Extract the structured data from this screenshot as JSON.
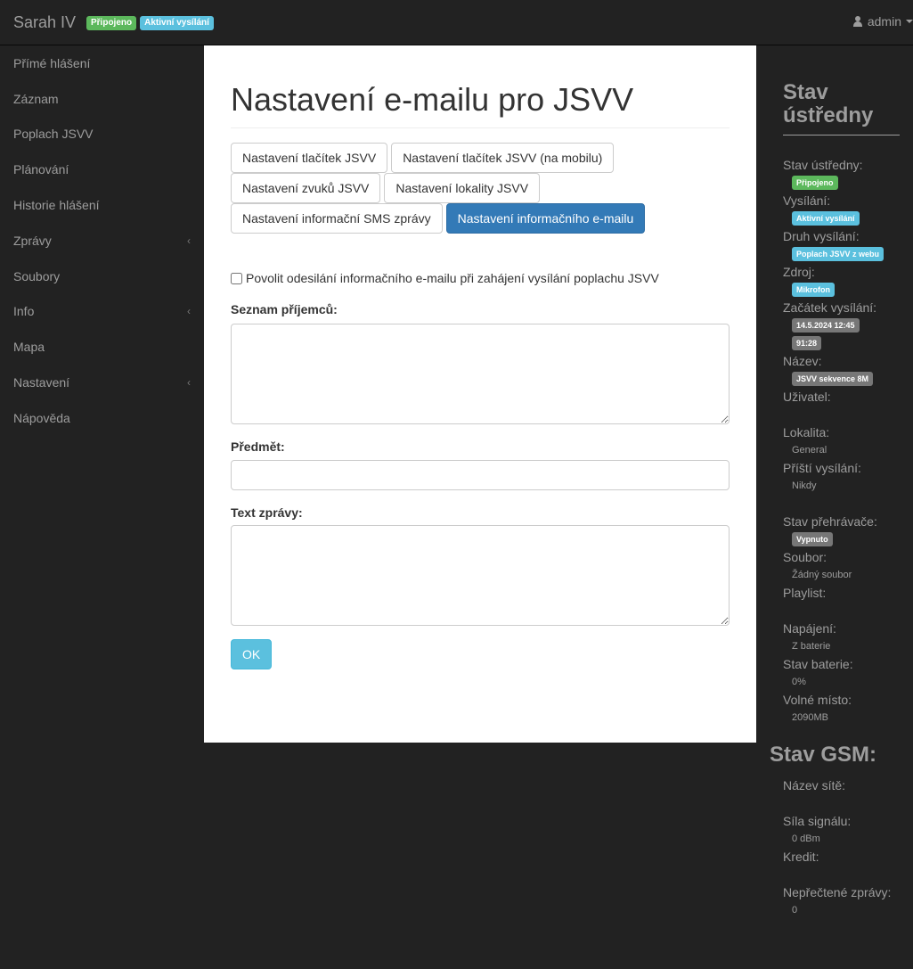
{
  "navbar": {
    "brand": "Sarah IV",
    "badge_connected": "Připojeno",
    "badge_broadcast": "Aktivní vysílání",
    "user": "admin"
  },
  "sidebar": {
    "items": [
      {
        "label": "Přímé hlášení",
        "has_chevron": false
      },
      {
        "label": "Záznam",
        "has_chevron": false
      },
      {
        "label": "Poplach JSVV",
        "has_chevron": false
      },
      {
        "label": "Plánování",
        "has_chevron": false
      },
      {
        "label": "Historie hlášení",
        "has_chevron": false
      },
      {
        "label": "Zprávy",
        "has_chevron": true
      },
      {
        "label": "Soubory",
        "has_chevron": false
      },
      {
        "label": "Info",
        "has_chevron": true
      },
      {
        "label": "Mapa",
        "has_chevron": false
      },
      {
        "label": "Nastavení",
        "has_chevron": true
      },
      {
        "label": "Nápověda",
        "has_chevron": false
      }
    ],
    "chevron": "‹"
  },
  "main": {
    "title": "Nastavení e-mailu pro JSVV",
    "tabs": [
      "Nastavení tlačítek JSVV",
      "Nastavení tlačítek JSVV (na mobilu)",
      "Nastavení zvuků JSVV",
      "Nastavení lokality JSVV",
      "Nastavení informační SMS zprávy",
      "Nastavení informačního e-mailu"
    ],
    "active_tab": 5,
    "checkbox_label": "Povolit odesilání informačního e-mailu při zahájení vysílání poplachu JSVV",
    "checkbox_checked": false,
    "recipients_label": "Seznam příjemců:",
    "recipients_value": "",
    "subject_label": "Předmět:",
    "subject_value": "",
    "message_label": "Text zprávy:",
    "message_value": "",
    "ok_label": "OK"
  },
  "status": {
    "title": "Stav ústředny",
    "central_state_label": "Stav ústředny:",
    "central_state": "Připojeno",
    "broadcast_label": "Vysílání:",
    "broadcast": "Aktivní vysílání",
    "broadcast_type_label": "Druh vysílání:",
    "broadcast_type": "Poplach JSVV z webu",
    "source_label": "Zdroj:",
    "source": "Mikrofon",
    "start_label": "Začátek vysílání:",
    "start_time": "14.5.2024 12:45",
    "duration": "91:28",
    "name_label": "Název:",
    "name": "JSVV sekvence 8M",
    "user_label": "Uživatel:",
    "location_label": "Lokalita:",
    "location": "General",
    "next_label": "Příští vysílání:",
    "next": "Nikdy",
    "player_label": "Stav přehrávače:",
    "player": "Vypnuto",
    "file_label": "Soubor:",
    "file": "Žádný soubor",
    "playlist_label": "Playlist:",
    "power_label": "Napájení:",
    "power": "Z baterie",
    "battery_label": "Stav baterie:",
    "battery": "0%",
    "space_label": "Volné místo:",
    "space": "2090MB"
  },
  "gsm": {
    "title": "Stav GSM:",
    "network_label": "Název sítě:",
    "signal_label": "Síla signálu:",
    "signal": "0 dBm",
    "credit_label": "Kredit:",
    "unread_label": "Nepřečtené zprávy:",
    "unread": "0"
  }
}
